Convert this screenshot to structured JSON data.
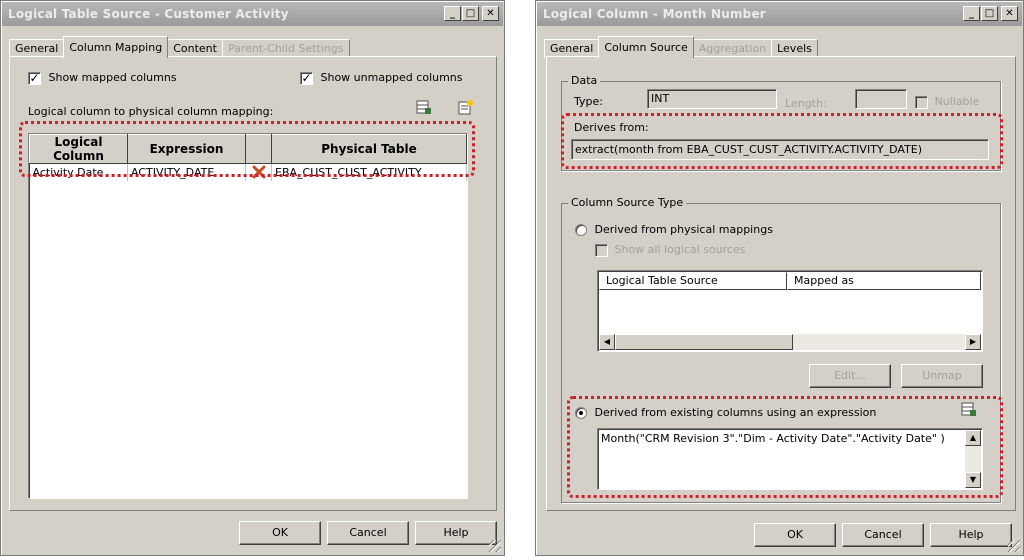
{
  "left": {
    "title": "Logical Table Source - Customer Activity",
    "tabs": [
      {
        "label": "General",
        "state": "normal"
      },
      {
        "label": "Column Mapping",
        "state": "active"
      },
      {
        "label": "Content",
        "state": "normal"
      },
      {
        "label": "Parent-Child Settings",
        "state": "disabled"
      }
    ],
    "show_mapped": {
      "label": "Show mapped columns",
      "checked": true
    },
    "show_unmapped": {
      "label": "Show unmapped columns",
      "checked": true
    },
    "mapping_label": "Logical column to physical column mapping:",
    "table": {
      "headers": [
        "Logical Column",
        "Expression",
        "",
        "Physical Table"
      ],
      "rows": [
        {
          "logical": "Activity Date",
          "expression": "ACTIVITY_DATE",
          "physical": "EBA_CUST_CUST_ACTIVITY"
        }
      ]
    },
    "buttons": {
      "ok": "OK",
      "cancel": "Cancel",
      "help": "Help"
    }
  },
  "right": {
    "title": "Logical Column - Month Number",
    "tabs": [
      {
        "label": "General",
        "state": "normal"
      },
      {
        "label": "Column Source",
        "state": "active"
      },
      {
        "label": "Aggregation",
        "state": "disabled"
      },
      {
        "label": "Levels",
        "state": "normal"
      }
    ],
    "data_group": "Data",
    "type_label": "Type:",
    "type_value": "INT",
    "length_label": "Length:",
    "nullable_label": "Nullable",
    "derives_label": "Derives from:",
    "derives_value": "extract(month from EBA_CUST_CUST_ACTIVITY.ACTIVITY_DATE)",
    "source_type_group": "Column Source Type",
    "opt_physical": {
      "label": "Derived from physical mappings",
      "selected": false
    },
    "show_all_sources": "Show all logical sources",
    "lts_headers": [
      "Logical Table Source",
      "Mapped as"
    ],
    "edit_button": "Edit...",
    "unmap_button": "Unmap",
    "opt_expression": {
      "label": "Derived from existing columns using an expression",
      "selected": true
    },
    "expression_value": "Month(\"CRM Revision 3\".\"Dim - Activity Date\".\"Activity Date\" )",
    "buttons": {
      "ok": "OK",
      "cancel": "Cancel",
      "help": "Help"
    }
  },
  "colors": {
    "highlight": "#d11f2a",
    "face": "#d4d0c8"
  }
}
